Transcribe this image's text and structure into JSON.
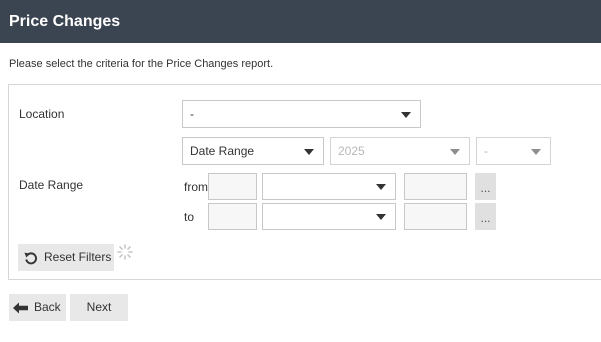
{
  "header": {
    "title": "Price Changes"
  },
  "intro": "Please select the criteria for the Price Changes report.",
  "form": {
    "location": {
      "label": "Location",
      "value": "-"
    },
    "date_range": {
      "label": "Date Range",
      "mode_value": "Date Range",
      "year_value": "2025",
      "period_value": "-",
      "from_label": "from",
      "to_label": "to",
      "picker_label": "..."
    },
    "reset_label": "Reset Filters"
  },
  "nav": {
    "back_label": "Back",
    "next_label": "Next"
  },
  "colors": {
    "header_bg": "#3b4451",
    "button_bg": "#e8e8e8"
  }
}
